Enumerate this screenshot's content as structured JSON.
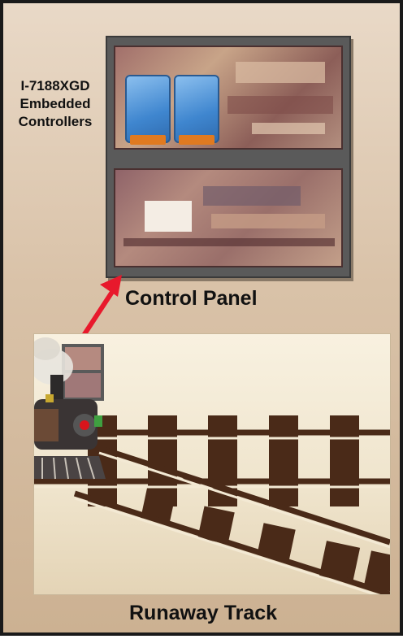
{
  "controllers_label": "I-7188XGD Embedded Controllers",
  "panel_caption": "Control Panel",
  "track_caption": "Runaway Track",
  "colors": {
    "arrow": "#e8192c",
    "rail": "#4a2a18",
    "cabinet": "#5a5a5a",
    "module": "#3f86cf"
  },
  "icons": [
    "arrow-icon",
    "steam-locomotive-icon",
    "controller-module-icon"
  ]
}
